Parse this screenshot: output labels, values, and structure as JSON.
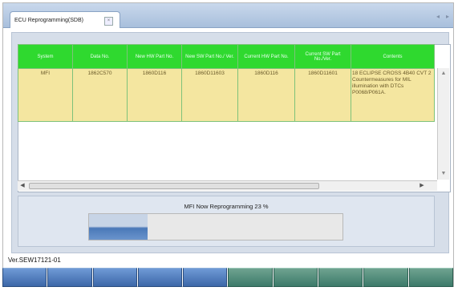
{
  "tab": {
    "label": "ECU Reprogramming(SDB)"
  },
  "nav": {
    "left": "◂",
    "right": "▸"
  },
  "table": {
    "headers": [
      "System",
      "Data No.",
      "New HW Part No.",
      "New SW Part No./ Ver.",
      "Current HW Part No.",
      "Current SW Part No./Ver.",
      "Contents"
    ],
    "rows": [
      [
        "MFI",
        "1862C570",
        "1860D116",
        "1860D11603",
        "1860D116",
        "1860D11601",
        "18 ECLIPSE CROSS 4B40 CVT    2 Countermeasures for MIL illumination with DTCs P0068/P061A."
      ]
    ]
  },
  "progress": {
    "label": "MFI Now Reprogramming 23 %",
    "fraction": 0.23
  },
  "version": "Ver.SEW17121-01",
  "footer": {
    "buttons": 10,
    "green_from": 5
  }
}
